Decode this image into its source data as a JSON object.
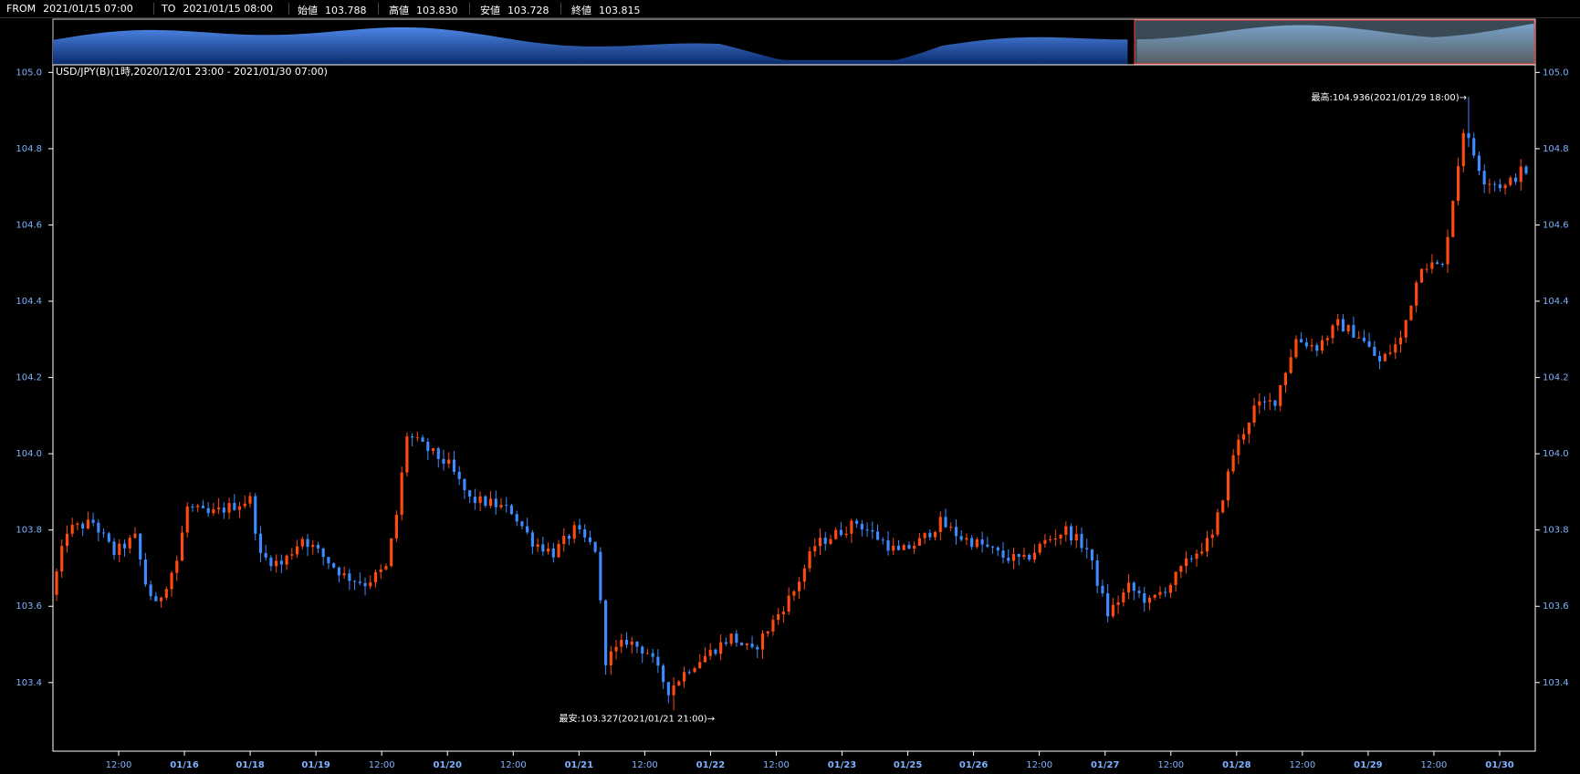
{
  "toolbar": {
    "from_label": "FROM",
    "from_value": "2021/01/15 07:00",
    "to_label": "TO",
    "to_value": "2021/01/15 08:00",
    "open_label": "始値",
    "open_value": "103.788",
    "high_label": "高値",
    "high_value": "103.830",
    "low_label": "安値",
    "low_value": "103.728",
    "close_label": "終値",
    "close_value": "103.815"
  },
  "colors": {
    "up": "#ff4a12",
    "down": "#3d8bff",
    "background": "#000000",
    "axis_text": "#7fb2ff",
    "navigator_fill": "#1e4fa8",
    "navigator_selected": "#6a7f8c"
  },
  "chart_data": {
    "type": "candlestick",
    "title": "USD/JPY(B)(1時,2020/12/01 23:00 - 2021/01/30 07:00)",
    "ylim": [
      103.22,
      105.02
    ],
    "yticks": [
      "105.0",
      "104.8",
      "104.6",
      "104.4",
      "104.2",
      "104.0",
      "103.8",
      "103.6",
      "103.4"
    ],
    "xticks": [
      {
        "label": "12:00",
        "bold": false
      },
      {
        "label": "01/16",
        "bold": true
      },
      {
        "label": "01/18",
        "bold": true
      },
      {
        "label": "01/19",
        "bold": true
      },
      {
        "label": "12:00",
        "bold": false
      },
      {
        "label": "01/20",
        "bold": true
      },
      {
        "label": "12:00",
        "bold": false
      },
      {
        "label": "01/21",
        "bold": true
      },
      {
        "label": "12:00",
        "bold": false
      },
      {
        "label": "01/22",
        "bold": true
      },
      {
        "label": "12:00",
        "bold": false
      },
      {
        "label": "01/23",
        "bold": true
      },
      {
        "label": "01/25",
        "bold": true
      },
      {
        "label": "01/26",
        "bold": true
      },
      {
        "label": "12:00",
        "bold": false
      },
      {
        "label": "01/27",
        "bold": true
      },
      {
        "label": "12:00",
        "bold": false
      },
      {
        "label": "01/28",
        "bold": true
      },
      {
        "label": "12:00",
        "bold": false
      },
      {
        "label": "01/29",
        "bold": true
      },
      {
        "label": "12:00",
        "bold": false
      },
      {
        "label": "01/30",
        "bold": true
      }
    ],
    "annotations": {
      "high": "最高:104.936(2021/01/29 18:00)→",
      "low": "最安:103.327(2021/01/21 21:00)→"
    },
    "keypoints": [
      [
        0,
        103.63
      ],
      [
        3,
        103.8
      ],
      [
        8,
        103.82
      ],
      [
        12,
        103.74
      ],
      [
        16,
        103.78
      ],
      [
        18,
        103.66
      ],
      [
        20,
        103.6
      ],
      [
        24,
        103.72
      ],
      [
        26,
        103.86
      ],
      [
        30,
        103.84
      ],
      [
        34,
        103.86
      ],
      [
        38,
        103.88
      ],
      [
        40,
        103.73
      ],
      [
        44,
        103.71
      ],
      [
        48,
        103.78
      ],
      [
        52,
        103.73
      ],
      [
        56,
        103.68
      ],
      [
        60,
        103.66
      ],
      [
        64,
        103.7
      ],
      [
        66,
        103.84
      ],
      [
        68,
        104.05
      ],
      [
        72,
        104.01
      ],
      [
        76,
        103.97
      ],
      [
        80,
        103.88
      ],
      [
        84,
        103.87
      ],
      [
        88,
        103.85
      ],
      [
        92,
        103.77
      ],
      [
        96,
        103.74
      ],
      [
        100,
        103.8
      ],
      [
        104,
        103.75
      ],
      [
        106,
        103.46
      ],
      [
        110,
        103.51
      ],
      [
        114,
        103.48
      ],
      [
        118,
        103.38
      ],
      [
        122,
        103.44
      ],
      [
        126,
        103.48
      ],
      [
        130,
        103.52
      ],
      [
        134,
        103.48
      ],
      [
        138,
        103.56
      ],
      [
        142,
        103.64
      ],
      [
        146,
        103.76
      ],
      [
        150,
        103.79
      ],
      [
        154,
        103.82
      ],
      [
        158,
        103.78
      ],
      [
        162,
        103.74
      ],
      [
        166,
        103.77
      ],
      [
        170,
        103.82
      ],
      [
        174,
        103.78
      ],
      [
        178,
        103.76
      ],
      [
        182,
        103.73
      ],
      [
        186,
        103.72
      ],
      [
        190,
        103.77
      ],
      [
        194,
        103.8
      ],
      [
        198,
        103.75
      ],
      [
        202,
        103.58
      ],
      [
        206,
        103.65
      ],
      [
        210,
        103.61
      ],
      [
        214,
        103.66
      ],
      [
        218,
        103.73
      ],
      [
        222,
        103.78
      ],
      [
        226,
        104.0
      ],
      [
        230,
        104.12
      ],
      [
        234,
        104.14
      ],
      [
        238,
        104.3
      ],
      [
        242,
        104.28
      ],
      [
        246,
        104.34
      ],
      [
        250,
        104.31
      ],
      [
        254,
        104.24
      ],
      [
        258,
        104.3
      ],
      [
        262,
        104.5
      ],
      [
        266,
        104.49
      ],
      [
        270,
        104.85
      ],
      [
        274,
        104.72
      ],
      [
        278,
        104.7
      ],
      [
        281,
        104.74
      ]
    ]
  }
}
